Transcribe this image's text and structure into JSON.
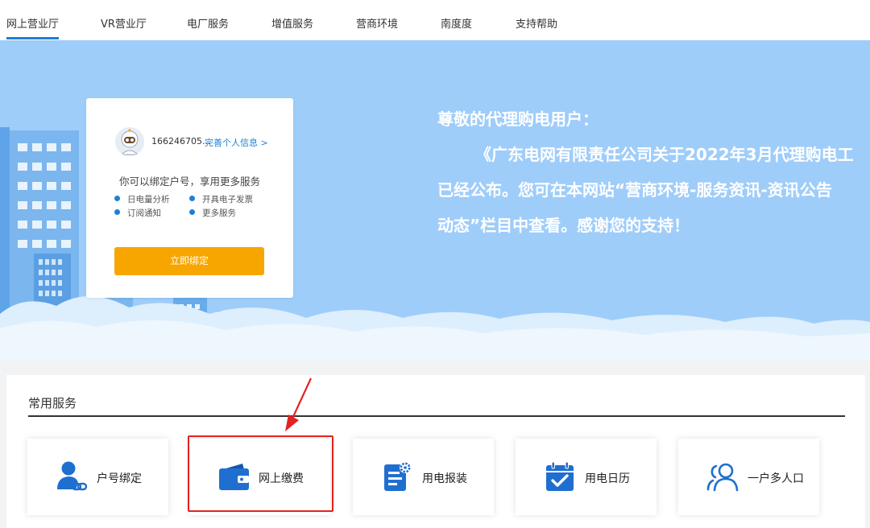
{
  "nav": {
    "items": [
      {
        "label": "网上营业厅",
        "active": true
      },
      {
        "label": "VR营业厅"
      },
      {
        "label": "电厂服务"
      },
      {
        "label": "增值服务"
      },
      {
        "label": "营商环境"
      },
      {
        "label": "南度度"
      },
      {
        "label": "支持帮助"
      }
    ]
  },
  "notice": {
    "line1": "尊敬的代理购电用户：",
    "line2": "《广东电网有限责任公司关于2022年3月代理购电工",
    "line3": "已经公布。您可在本网站“营商环境-服务资讯-资讯公告",
    "line4": "动态”栏目中查看。感谢您的支持！"
  },
  "user_card": {
    "username": "166246705...",
    "profile_link": "完善个人信息 >",
    "bind_tip": "你可以绑定户号，享用更多服务",
    "features": [
      "日电量分析",
      "开具电子发票",
      "订阅通知",
      "更多服务"
    ],
    "bind_button": "立即绑定"
  },
  "services": {
    "title": "常用服务",
    "tiles": [
      {
        "label": "户号绑定",
        "icon": "user-link-icon"
      },
      {
        "label": "网上缴费",
        "icon": "wallet-icon",
        "highlighted": true
      },
      {
        "label": "用电报装",
        "icon": "document-gear-icon"
      },
      {
        "label": "用电日历",
        "icon": "calendar-check-icon"
      },
      {
        "label": "一户多人口",
        "icon": "multi-user-icon"
      }
    ]
  },
  "colors": {
    "accent": "#1f7fd6",
    "banner": "#9fcdfa",
    "bind_button": "#f7a600",
    "highlight": "#e32222"
  }
}
